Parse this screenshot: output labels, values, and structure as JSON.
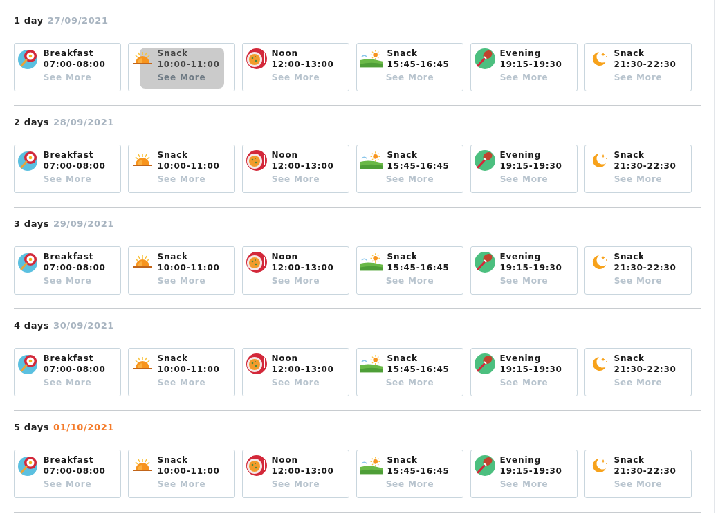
{
  "days": [
    {
      "label": "1 day",
      "date": "27/09/2021",
      "current": false,
      "meals": [
        {
          "kind": "breakfast",
          "name": "Breakfast",
          "time": "07:00-08:00",
          "link": "See More",
          "hovered": false
        },
        {
          "kind": "sunrise",
          "name": "Snack",
          "time": "10:00-11:00",
          "link": "See More",
          "hovered": true
        },
        {
          "kind": "noon",
          "name": "Noon",
          "time": "12:00-13:00",
          "link": "See More",
          "hovered": false
        },
        {
          "kind": "afternoon",
          "name": "Snack",
          "time": "15:45-16:45",
          "link": "See More",
          "hovered": false
        },
        {
          "kind": "evening",
          "name": "Evening",
          "time": "19:15-19:30",
          "link": "See More",
          "hovered": false
        },
        {
          "kind": "night",
          "name": "Snack",
          "time": "21:30-22:30",
          "link": "See More",
          "hovered": false
        }
      ]
    },
    {
      "label": "2 days",
      "date": "28/09/2021",
      "current": false,
      "meals": [
        {
          "kind": "breakfast",
          "name": "Breakfast",
          "time": "07:00-08:00",
          "link": "See More",
          "hovered": false
        },
        {
          "kind": "sunrise",
          "name": "Snack",
          "time": "10:00-11:00",
          "link": "See More",
          "hovered": false
        },
        {
          "kind": "noon",
          "name": "Noon",
          "time": "12:00-13:00",
          "link": "See More",
          "hovered": false
        },
        {
          "kind": "afternoon",
          "name": "Snack",
          "time": "15:45-16:45",
          "link": "See More",
          "hovered": false
        },
        {
          "kind": "evening",
          "name": "Evening",
          "time": "19:15-19:30",
          "link": "See More",
          "hovered": false
        },
        {
          "kind": "night",
          "name": "Snack",
          "time": "21:30-22:30",
          "link": "See More",
          "hovered": false
        }
      ]
    },
    {
      "label": "3 days",
      "date": "29/09/2021",
      "current": false,
      "meals": [
        {
          "kind": "breakfast",
          "name": "Breakfast",
          "time": "07:00-08:00",
          "link": "See More",
          "hovered": false
        },
        {
          "kind": "sunrise",
          "name": "Snack",
          "time": "10:00-11:00",
          "link": "See More",
          "hovered": false
        },
        {
          "kind": "noon",
          "name": "Noon",
          "time": "12:00-13:00",
          "link": "See More",
          "hovered": false
        },
        {
          "kind": "afternoon",
          "name": "Snack",
          "time": "15:45-16:45",
          "link": "See More",
          "hovered": false
        },
        {
          "kind": "evening",
          "name": "Evening",
          "time": "19:15-19:30",
          "link": "See More",
          "hovered": false
        },
        {
          "kind": "night",
          "name": "Snack",
          "time": "21:30-22:30",
          "link": "See More",
          "hovered": false
        }
      ]
    },
    {
      "label": "4 days",
      "date": "30/09/2021",
      "current": false,
      "meals": [
        {
          "kind": "breakfast",
          "name": "Breakfast",
          "time": "07:00-08:00",
          "link": "See More",
          "hovered": false
        },
        {
          "kind": "sunrise",
          "name": "Snack",
          "time": "10:00-11:00",
          "link": "See More",
          "hovered": false
        },
        {
          "kind": "noon",
          "name": "Noon",
          "time": "12:00-13:00",
          "link": "See More",
          "hovered": false
        },
        {
          "kind": "afternoon",
          "name": "Snack",
          "time": "15:45-16:45",
          "link": "See More",
          "hovered": false
        },
        {
          "kind": "evening",
          "name": "Evening",
          "time": "19:15-19:30",
          "link": "See More",
          "hovered": false
        },
        {
          "kind": "night",
          "name": "Snack",
          "time": "21:30-22:30",
          "link": "See More",
          "hovered": false
        }
      ]
    },
    {
      "label": "5 days",
      "date": "01/10/2021",
      "current": true,
      "meals": [
        {
          "kind": "breakfast",
          "name": "Breakfast",
          "time": "07:00-08:00",
          "link": "See More",
          "hovered": false
        },
        {
          "kind": "sunrise",
          "name": "Snack",
          "time": "10:00-11:00",
          "link": "See More",
          "hovered": false
        },
        {
          "kind": "noon",
          "name": "Noon",
          "time": "12:00-13:00",
          "link": "See More",
          "hovered": false
        },
        {
          "kind": "afternoon",
          "name": "Snack",
          "time": "15:45-16:45",
          "link": "See More",
          "hovered": false
        },
        {
          "kind": "evening",
          "name": "Evening",
          "time": "19:15-19:30",
          "link": "See More",
          "hovered": false
        },
        {
          "kind": "night",
          "name": "Snack",
          "time": "21:30-22:30",
          "link": "See More",
          "hovered": false
        }
      ]
    }
  ]
}
